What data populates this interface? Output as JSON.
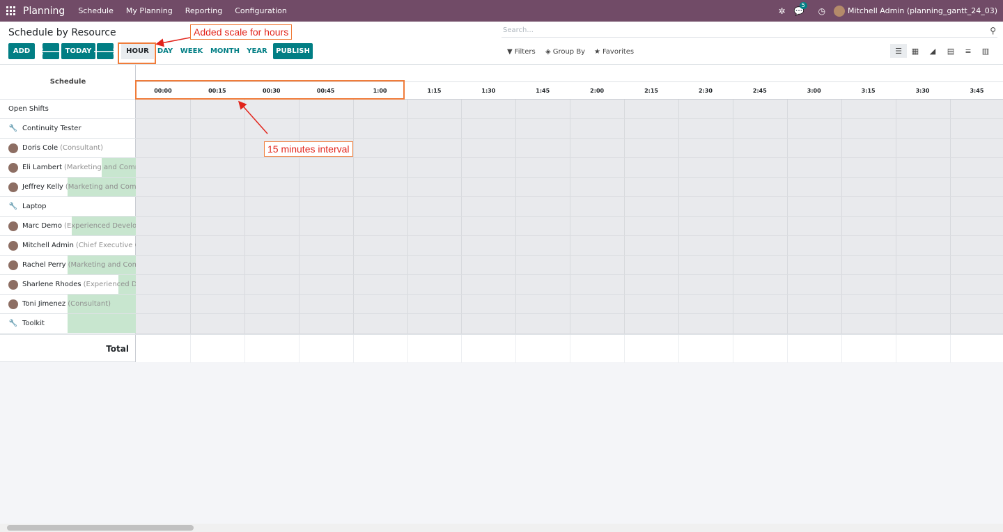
{
  "navbar": {
    "app_name": "Planning",
    "menus": [
      "Schedule",
      "My Planning",
      "Reporting",
      "Configuration"
    ],
    "chat_badge": "5",
    "user": "Mitchell Admin (planning_gantt_24_03)"
  },
  "control": {
    "title": "Schedule by Resource",
    "add": "ADD",
    "today": "TODAY",
    "scales": [
      "HOUR",
      "DAY",
      "WEEK",
      "MONTH",
      "YEAR"
    ],
    "active_scale": "HOUR",
    "publish": "PUBLISH",
    "search_placeholder": "Search...",
    "filters": "Filters",
    "group_by": "Group By",
    "favorites": "Favorites"
  },
  "gantt": {
    "schedule_header": "Schedule",
    "ticks": [
      "00:00",
      "00:15",
      "00:30",
      "00:45",
      "1:00",
      "1:15",
      "1:30",
      "1:45",
      "2:00",
      "2:15",
      "2:30",
      "2:45",
      "3:00",
      "3:15",
      "3:30",
      "3:45"
    ],
    "rows": [
      {
        "name": "Open Shifts",
        "role": "",
        "icon": "none"
      },
      {
        "name": "Continuity Tester",
        "role": "",
        "icon": "wrench-icon"
      },
      {
        "name": "Doris Cole",
        "role": "(Consultant)",
        "icon": "avatar"
      },
      {
        "name": "Eli Lambert",
        "role": "(Marketing and Commu",
        "icon": "avatar"
      },
      {
        "name": "Jeffrey Kelly",
        "role": "(Marketing and Comm",
        "icon": "avatar"
      },
      {
        "name": "Laptop",
        "role": "",
        "icon": "wrench-icon"
      },
      {
        "name": "Marc Demo",
        "role": "(Experienced Develope",
        "icon": "avatar"
      },
      {
        "name": "Mitchell Admin",
        "role": "(Chief Executive Off",
        "icon": "avatar"
      },
      {
        "name": "Rachel Perry",
        "role": "(Marketing and Comm",
        "icon": "avatar"
      },
      {
        "name": "Sharlene Rhodes",
        "role": "(Experienced Deve",
        "icon": "avatar"
      },
      {
        "name": "Toni Jimenez",
        "role": "(Consultant)",
        "icon": "avatar"
      },
      {
        "name": "Toolkit",
        "role": "",
        "icon": "wrench-icon"
      }
    ],
    "total_label": "Total"
  },
  "annotations": {
    "scale_note": "Added scale for hours",
    "interval_note": "15 minutes interval",
    "color": "#f07c3a",
    "text_color": "#e2241b"
  },
  "colors": {
    "brand": "#714b67",
    "accent": "#017e84",
    "allocation_bar": "#c8e6cf"
  }
}
